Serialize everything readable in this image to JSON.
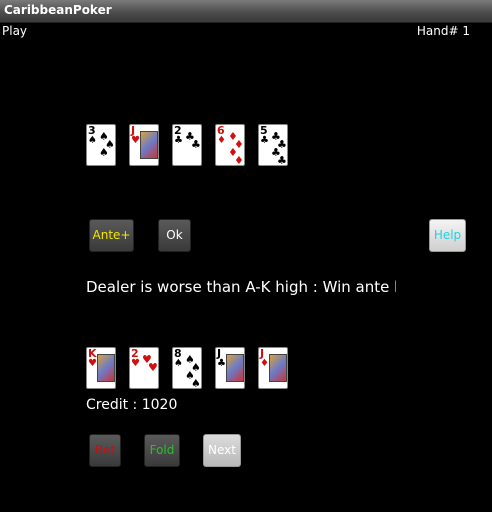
{
  "window": {
    "title": "CaribbeanPoker"
  },
  "menu": {
    "play_label": "Play",
    "hand_label": "Hand# 1"
  },
  "dealer_cards": [
    {
      "rank": "3",
      "suit": "spade",
      "color": "black"
    },
    {
      "rank": "J",
      "suit": "heart",
      "color": "red"
    },
    {
      "rank": "2",
      "suit": "club",
      "color": "black"
    },
    {
      "rank": "6",
      "suit": "diamond",
      "color": "red"
    },
    {
      "rank": "5",
      "suit": "club",
      "color": "black"
    }
  ],
  "buttons": {
    "ante_label": "Ante+",
    "ok_label": "Ok",
    "help_label": "Help",
    "bet_label": "Bet",
    "fold_label": "Fold",
    "next_label": "Next"
  },
  "message": "Dealer is worse than A-K high : Win ante bet",
  "player_cards": [
    {
      "rank": "K",
      "suit": "heart",
      "color": "red"
    },
    {
      "rank": "2",
      "suit": "heart",
      "color": "red"
    },
    {
      "rank": "8",
      "suit": "spade",
      "color": "black"
    },
    {
      "rank": "J",
      "suit": "club",
      "color": "black"
    },
    {
      "rank": "J",
      "suit": "diamond",
      "color": "red"
    }
  ],
  "credit": "Credit : 1020",
  "colors": {
    "background": "#000000",
    "ante_text": "#f2e600",
    "help_text": "#19d6e6",
    "bet_text": "#c41010",
    "fold_text": "#27c227"
  }
}
